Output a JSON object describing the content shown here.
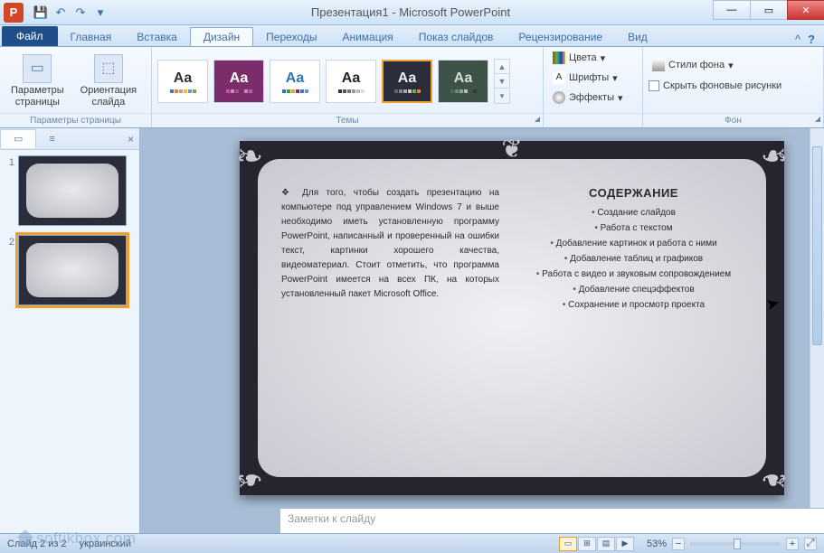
{
  "title": "Презентация1 - Microsoft PowerPoint",
  "app_icon_letter": "P",
  "qat": {
    "save": "💾",
    "undo": "↶",
    "redo": "↷",
    "more": "▾"
  },
  "win": {
    "min": "—",
    "max": "▭",
    "close": "✕"
  },
  "tabs": {
    "file": "Файл",
    "home": "Главная",
    "insert": "Вставка",
    "design": "Дизайн",
    "transitions": "Переходы",
    "animation": "Анимация",
    "slideshow": "Показ слайдов",
    "review": "Рецензирование",
    "view": "Вид"
  },
  "ribbon": {
    "page_setup": {
      "label": "Параметры страницы",
      "btn1": "Параметры\nстраницы",
      "btn2": "Ориентация\nслайда"
    },
    "themes_label": "Темы",
    "themes": [
      {
        "bg": "#ffffff",
        "fg": "#323232",
        "dots": [
          "#4472c4",
          "#ed7d31",
          "#a5a5a5",
          "#ffc000",
          "#5b9bd5",
          "#70ad47"
        ]
      },
      {
        "bg": "#7b2d6b",
        "fg": "#ffffff",
        "dots": [
          "#c84fa8",
          "#e084c5",
          "#a34d8f",
          "#7b2d6b",
          "#d07fb8",
          "#b560a0"
        ]
      },
      {
        "bg": "#ffffff",
        "fg": "#2e75b6",
        "dots": [
          "#2e75b6",
          "#28a745",
          "#f0a030",
          "#7b2d6b",
          "#4472c4",
          "#5b9bd5"
        ]
      },
      {
        "bg": "#ffffff",
        "fg": "#222222",
        "dots": [
          "#333",
          "#555",
          "#777",
          "#999",
          "#bbb",
          "#ddd"
        ]
      },
      {
        "bg": "#2b2d3a",
        "fg": "#eeeeee",
        "dots": [
          "#666",
          "#888",
          "#aaa",
          "#ccc",
          "#70ad47",
          "#ed7d31"
        ]
      },
      {
        "bg": "#3e5247",
        "fg": "#cde0d2",
        "dots": [
          "#4e6a5a",
          "#6c8975",
          "#8aa890",
          "#a8c7ab",
          "#3e5247",
          "#2d3d34"
        ]
      }
    ],
    "variants": {
      "colors": "Цвета",
      "fonts": "Шрифты",
      "effects": "Эффекты"
    },
    "background": {
      "label": "Фон",
      "styles": "Стили фона",
      "hide": "Скрыть фоновые рисунки"
    }
  },
  "thumbs": {
    "tab_outline": "",
    "close": "×",
    "slides": [
      "1",
      "2"
    ]
  },
  "slide": {
    "left_text": "❖ Для того, чтобы создать презентацию на компьютере под управлением Windows 7 и выше необходимо иметь установленную программу PowerPoint, написанный и проверенный на ошибки текст, картинки хорошего качества, видеоматериал. Стоит отметить, что программа PowerPoint имеется на всех ПК, на которых установленный пакет Microsoft Office.",
    "title": "СОДЕРЖАНИЕ",
    "items": [
      "Создание слайдов",
      "Работа с текстом",
      "Добавление картинок и работа с ними",
      "Добавление таблиц и графиков",
      "Работа с видео и звуковым сопровождением",
      "Добавление спецэффектов",
      "Сохранение и просмотр проекта"
    ]
  },
  "notes_placeholder": "Заметки к слайду",
  "status": {
    "slide": "Слайд 2 из 2",
    "lang": "украинский",
    "zoom": "53%",
    "fit": "⤢"
  },
  "watermark": "softikbox.com"
}
